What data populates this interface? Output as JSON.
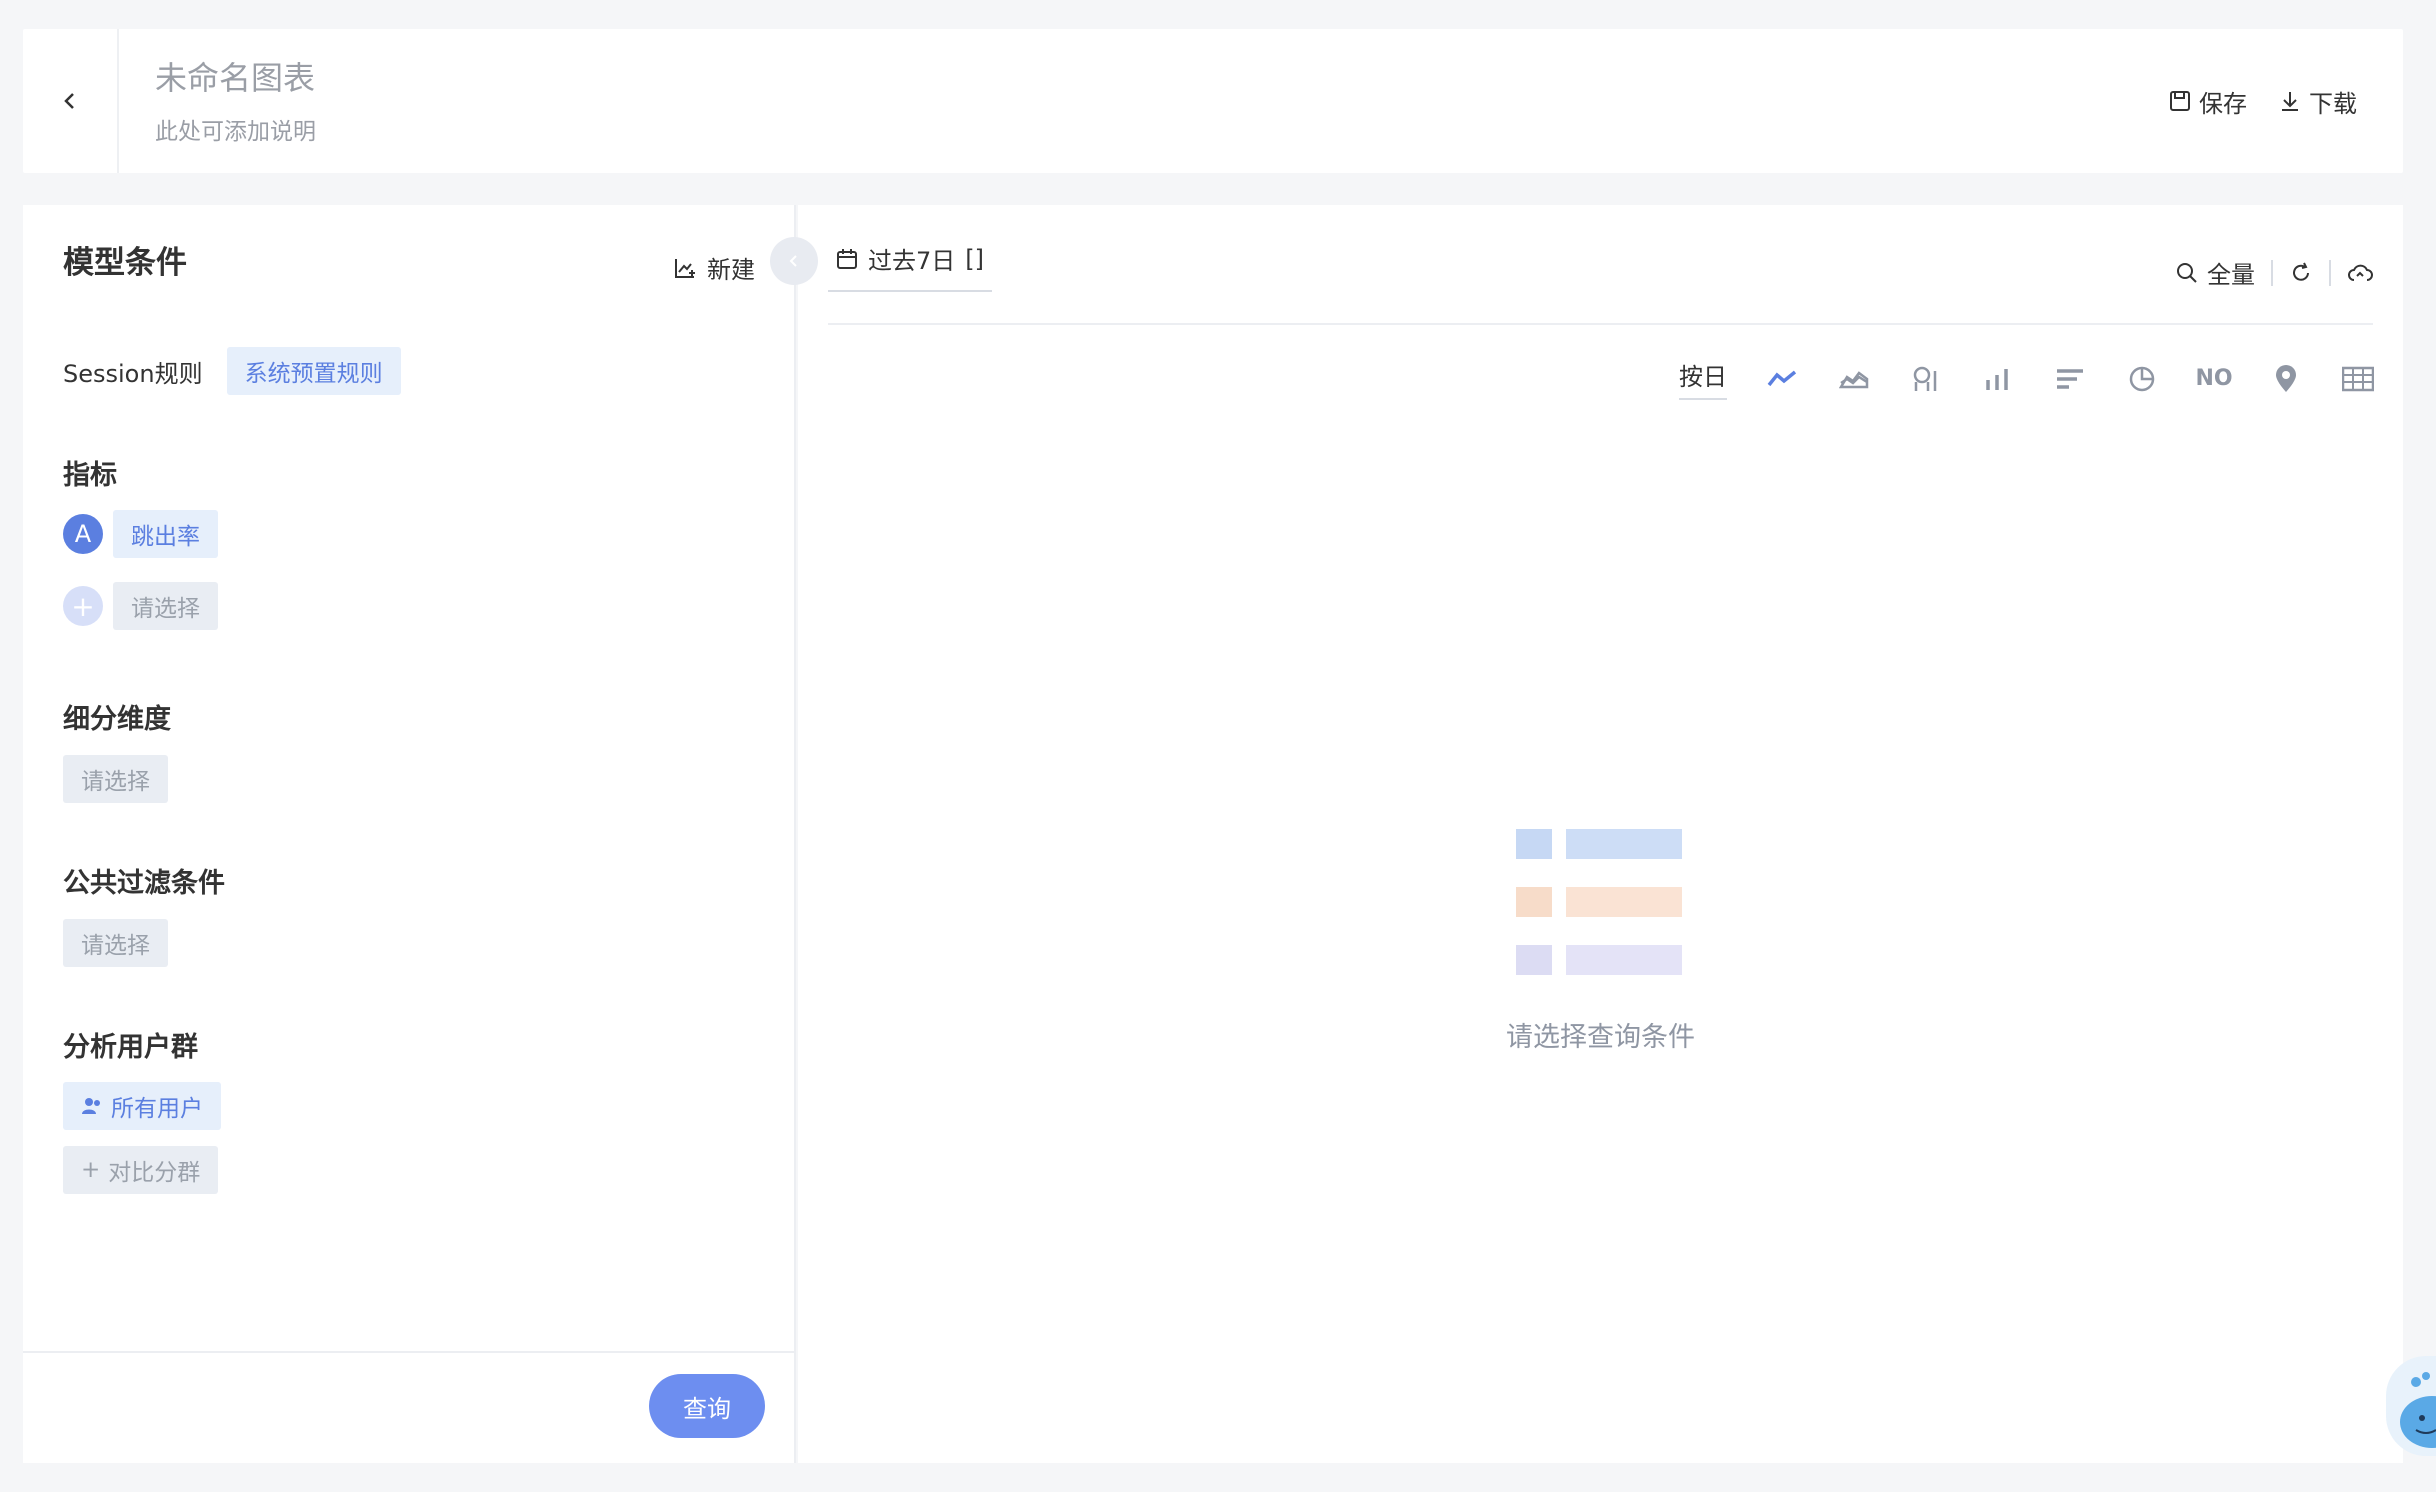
{
  "header": {
    "title": "未命名图表",
    "description": "此处可添加说明",
    "save_label": "保存",
    "download_label": "下载"
  },
  "left_panel": {
    "title": "模型条件",
    "new_label": "新建",
    "session_label": "Session规则",
    "session_rule": "系统预置规则",
    "metrics_title": "指标",
    "metric_badge": "A",
    "metric_value": "跳出率",
    "metric_add_placeholder": "请选择",
    "dimension_title": "细分维度",
    "dimension_placeholder": "请选择",
    "filter_title": "公共过滤条件",
    "filter_placeholder": "请选择",
    "segment_title": "分析用户群",
    "segment_value": "所有用户",
    "segment_compare": "对比分群",
    "query_label": "查询"
  },
  "right_panel": {
    "date_range": "过去7日",
    "date_suffix": "[]",
    "scope_label": "全量",
    "granularity": "按日",
    "empty_message": "请选择查询条件",
    "number_icon_text": "NO"
  },
  "colors": {
    "accent": "#5b7fe0",
    "tag_bg": "#e6effb",
    "query_button": "#6d8ef0"
  }
}
